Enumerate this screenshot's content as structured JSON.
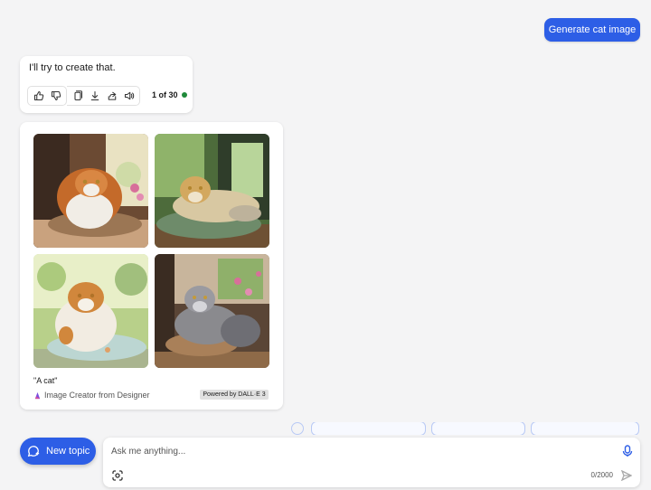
{
  "conversation": {
    "user_message": "Generate cat image",
    "bot_reply": "I'll try to create that.",
    "response_counter": "1 of 30",
    "status_color": "#1f8a3a"
  },
  "actions": {
    "icons": [
      "thumbs-up-icon",
      "thumbs-down-icon",
      "copy-icon",
      "download-icon",
      "share-icon",
      "speaker-icon"
    ]
  },
  "image_result": {
    "caption": "\"A cat\"",
    "creator": "Image Creator from Designer",
    "powered_by": "Powered by DALL·E 3"
  },
  "composer": {
    "placeholder": "Ask me anything...",
    "char_count": "0/2000"
  },
  "new_topic": {
    "label": "New topic"
  },
  "colors": {
    "accent": "#2d5ee6",
    "background": "#f4f4f5"
  }
}
